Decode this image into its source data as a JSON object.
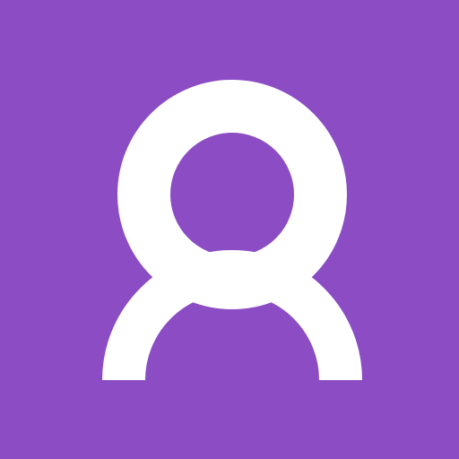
{
  "app_icon": {
    "icon_name": "user-profile-icon",
    "background_color": "#8b4cc4",
    "glyph_color": "#ffffff"
  }
}
